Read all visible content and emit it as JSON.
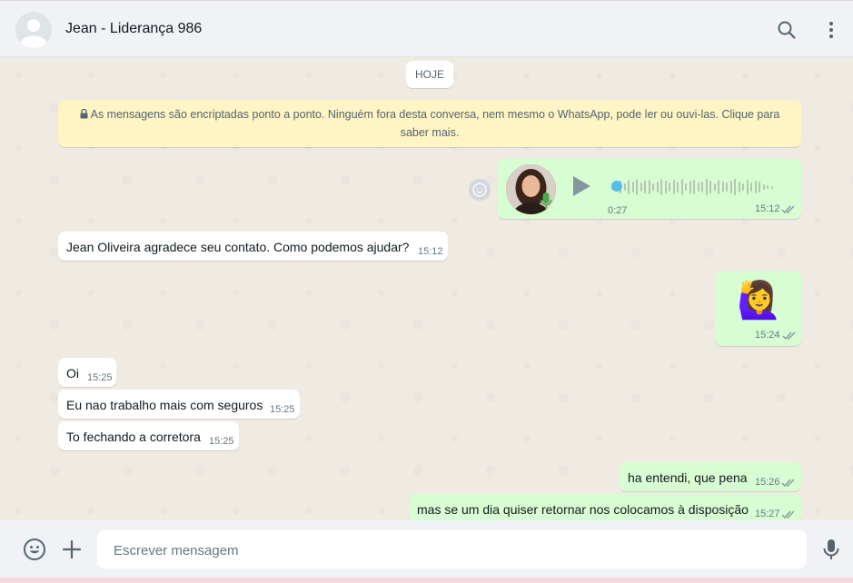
{
  "header": {
    "title": "Jean - Liderança 986",
    "icons": [
      "avatar-placeholder",
      "search-icon",
      "menu-icon"
    ]
  },
  "chat": {
    "date_chip": "HOJE",
    "encryption_notice": "As mensagens são encriptadas ponto a ponto. Ninguém fora desta conversa, nem mesmo o WhatsApp, pode ler ou ouvi-las. Clique para saber mais.",
    "messages": [
      {
        "direction": "out",
        "type": "voice",
        "duration": "0:27",
        "time": "15:12",
        "status": "read"
      },
      {
        "direction": "in",
        "type": "text",
        "text": "Jean Oliveira  agradece seu contato. Como podemos ajudar?",
        "time": "15:12"
      },
      {
        "direction": "out",
        "type": "sticker",
        "emoji": "🙋‍♀️",
        "time": "15:24",
        "status": "read"
      },
      {
        "direction": "in",
        "type": "text",
        "text": "Oi",
        "time": "15:25"
      },
      {
        "direction": "in",
        "type": "text",
        "text": "Eu nao trabalho mais com seguros",
        "time": "15:25"
      },
      {
        "direction": "in",
        "type": "text",
        "text": "To fechando a corretora",
        "time": "15:25"
      },
      {
        "direction": "out",
        "type": "text",
        "text": "ha entendi, que pena",
        "time": "15:26",
        "status": "read"
      },
      {
        "direction": "out",
        "type": "text",
        "text": "mas se um dia quiser retornar nos colocamos à disposição",
        "time": "15:27",
        "status": "read"
      }
    ]
  },
  "composer": {
    "placeholder": "Escrever mensagem",
    "icons": [
      "emoji-icon",
      "attach-plus-icon",
      "microphone-icon"
    ]
  },
  "colors": {
    "outgoing_bubble": "#d9fdd3",
    "incoming_bubble": "#ffffff",
    "notice_bg": "#fff4c4",
    "header_bg": "#f0f2f5",
    "chat_bg": "#efeae2",
    "read_ticks": "#8696a0",
    "voice_dot": "#53bdeb"
  }
}
